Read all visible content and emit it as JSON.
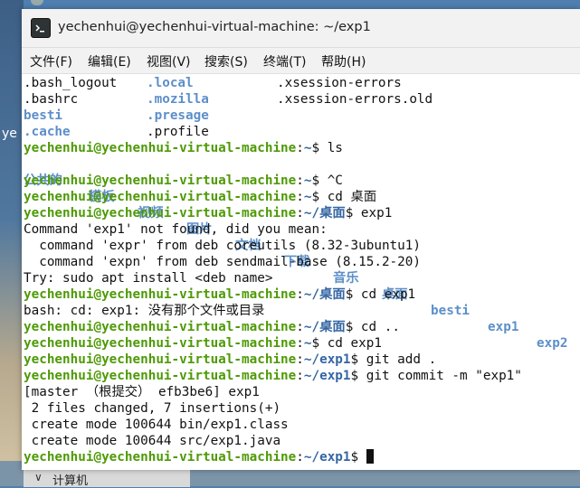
{
  "window": {
    "title": "yechenhui@yechenhui-virtual-machine: ~/exp1"
  },
  "menu": [
    "文件(F)",
    "编辑(E)",
    "视图(V)",
    "搜索(S)",
    "终端(T)",
    "帮助(H)"
  ],
  "desktop": {
    "left_text": "ye",
    "sidebar_item": "计算机"
  },
  "terminal": {
    "ls_row1": [
      ".bash_logout",
      ".local",
      ".xsession-errors"
    ],
    "ls_row2": [
      ".bashrc",
      ".mozilla",
      ".xsession-errors.old"
    ],
    "ls_row3": [
      "besti",
      ".presage",
      ".profile"
    ],
    "ls_row4": [
      ".cache"
    ],
    "prompt_user": "yechenhui@yechenhui-virtual-machine",
    "path_home": "~",
    "path_desktop": "~/桌面",
    "path_exp1": "~/exp1",
    "cmd_ls": "ls",
    "home_listing": [
      "公共的",
      "模板",
      "视频",
      "图片",
      "文档",
      "下载",
      "音乐",
      "桌面",
      "besti",
      "exp1",
      "exp2"
    ],
    "cmd_ctrlc": "^C",
    "cmd_cd_desktop": "cd 桌面",
    "cmd_exp1": "exp1",
    "out_not_found": "Command 'exp1' not found, did you mean:",
    "out_suggest1": "  command 'expr' from deb coreutils (8.32-3ubuntu1)",
    "out_suggest2": "  command 'expn' from deb sendmail-base (8.15.2-20)",
    "out_try": "Try: sudo apt install <deb name>",
    "cmd_cd_exp1": "cd exp1",
    "out_bash_cd": "bash: cd: exp1: 没有那个文件或目录",
    "cmd_cd_up": "cd ..",
    "cmd_git_add": "git add .",
    "cmd_git_commit": "git commit -m \"exp1\"",
    "out_commit1": "[master （根提交） efb3be6] exp1",
    "out_commit2": " 2 files changed, 7 insertions(+)",
    "out_commit3": " create mode 100644 bin/exp1.class",
    "out_commit4": " create mode 100644 src/exp1.java"
  },
  "colors": {
    "prompt_green": "#4e9a06",
    "dir_blue": "#3465a4"
  }
}
